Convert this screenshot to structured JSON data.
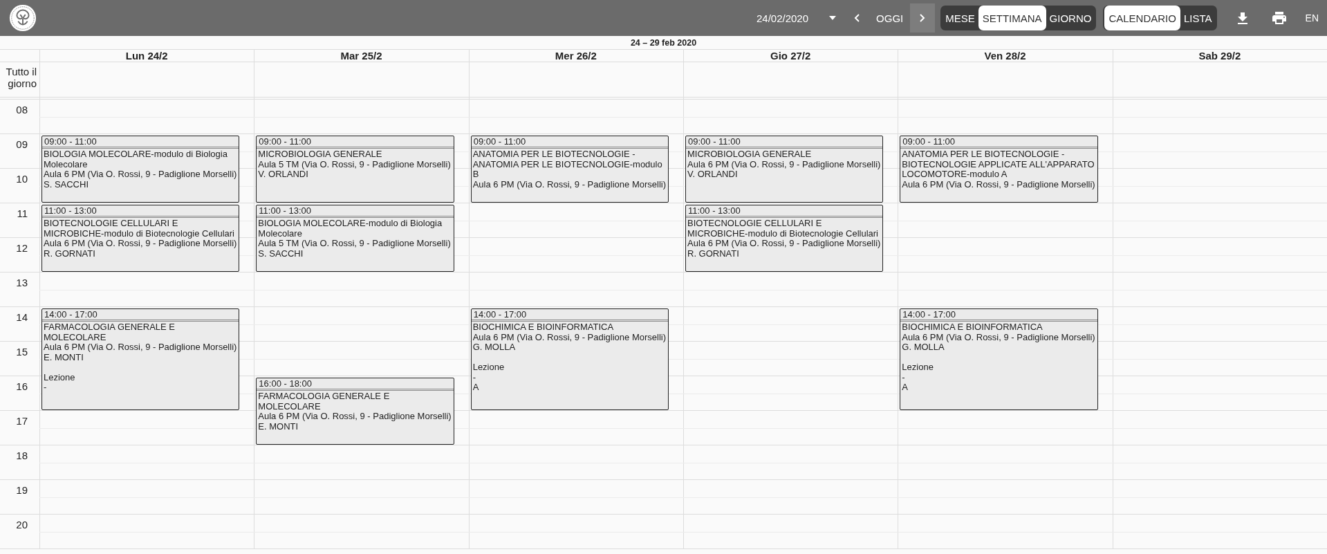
{
  "toolbar": {
    "date_field": {
      "value": "24/02/2020"
    },
    "today_button": "OGGI",
    "view_modes": [
      {
        "label": "MESE",
        "selected": false
      },
      {
        "label": "SETTIMANA",
        "selected": true
      },
      {
        "label": "GIORNO",
        "selected": false
      }
    ],
    "display_modes": [
      {
        "label": "CALENDARIO",
        "selected": true
      },
      {
        "label": "LISTA",
        "selected": false
      }
    ],
    "language": "EN"
  },
  "calendar": {
    "range_title": "24 – 29 feb 2020",
    "all_day_label": "Tutto il giorno",
    "hours": [
      "08",
      "09",
      "10",
      "11",
      "12",
      "13",
      "14",
      "15",
      "16",
      "17",
      "18",
      "19",
      "20"
    ],
    "days": [
      {
        "label": "Lun 24/2",
        "events": [
          {
            "time": "09:00 - 11:00",
            "title": "BIOLOGIA MOLECOLARE-modulo di Biologia Molecolare",
            "room": "Aula 6 PM (Via O. Rossi, 9 - Padiglione Morselli)",
            "teacher": "S. SACCHI"
          },
          {
            "time": "11:00 - 13:00",
            "title": "BIOTECNOLOGIE CELLULARI E MICROBICHE-modulo di Biotecnologie Cellulari",
            "room": "Aula 6 PM (Via O. Rossi, 9 - Padiglione Morselli)",
            "teacher": "R. GORNATI"
          },
          {
            "time": "14:00 - 17:00",
            "title": "FARMACOLOGIA GENERALE E MOLECOLARE",
            "room": "Aula 6 PM (Via O. Rossi, 9 - Padiglione Morselli)",
            "teacher": "E. MONTI",
            "notes": [
              "Lezione",
              "-"
            ]
          }
        ]
      },
      {
        "label": "Mar 25/2",
        "events": [
          {
            "time": "09:00 - 11:00",
            "title": "MICROBIOLOGIA GENERALE",
            "room": "Aula 5 TM (Via O. Rossi, 9 - Padiglione Morselli)",
            "teacher": "V. ORLANDI"
          },
          {
            "time": "11:00 - 13:00",
            "title": "BIOLOGIA MOLECOLARE-modulo di Biologia Molecolare",
            "room": "Aula 5 TM (Via O. Rossi, 9 - Padiglione Morselli)",
            "teacher": "S. SACCHI"
          },
          {
            "time": "16:00 - 18:00",
            "title": "FARMACOLOGIA GENERALE E MOLECOLARE",
            "room": "Aula 6 PM (Via O. Rossi, 9 - Padiglione Morselli)",
            "teacher": "E. MONTI"
          }
        ]
      },
      {
        "label": "Mer 26/2",
        "events": [
          {
            "time": "09:00 - 11:00",
            "title": "ANATOMIA PER LE BIOTECNOLOGIE - ANATOMIA PER LE BIOTECNOLOGIE-modulo B",
            "room": "Aula 6 PM (Via O. Rossi, 9 - Padiglione Morselli)"
          },
          {
            "time": "14:00 - 17:00",
            "title": "BIOCHIMICA E BIOINFORMATICA",
            "room": "Aula 6 PM (Via O. Rossi, 9 - Padiglione Morselli)",
            "teacher": "G. MOLLA",
            "notes": [
              "Lezione",
              "-",
              "A"
            ]
          }
        ]
      },
      {
        "label": "Gio 27/2",
        "events": [
          {
            "time": "09:00 - 11:00",
            "title": "MICROBIOLOGIA GENERALE",
            "room": "Aula 6 PM (Via O. Rossi, 9 - Padiglione Morselli)",
            "teacher": "V. ORLANDI"
          },
          {
            "time": "11:00 - 13:00",
            "title": "BIOTECNOLOGIE CELLULARI E MICROBICHE-modulo di Biotecnologie Cellulari",
            "room": "Aula 6 PM (Via O. Rossi, 9 - Padiglione Morselli)",
            "teacher": "R. GORNATI"
          }
        ]
      },
      {
        "label": "Ven 28/2",
        "events": [
          {
            "time": "09:00 - 11:00",
            "title": "ANATOMIA PER LE BIOTECNOLOGIE - BIOTECNOLOGIE APPLICATE ALL'APPARATO LOCOMOTORE-modulo A",
            "room": "Aula 6 PM (Via O. Rossi, 9 - Padiglione Morselli)"
          },
          {
            "time": "14:00 - 17:00",
            "title": "BIOCHIMICA E BIOINFORMATICA",
            "room": "Aula 6 PM (Via O. Rossi, 9 - Padiglione Morselli)",
            "teacher": "G. MOLLA",
            "notes": [
              "Lezione",
              "-",
              "A"
            ]
          }
        ]
      },
      {
        "label": "Sab 29/2"
      }
    ]
  }
}
